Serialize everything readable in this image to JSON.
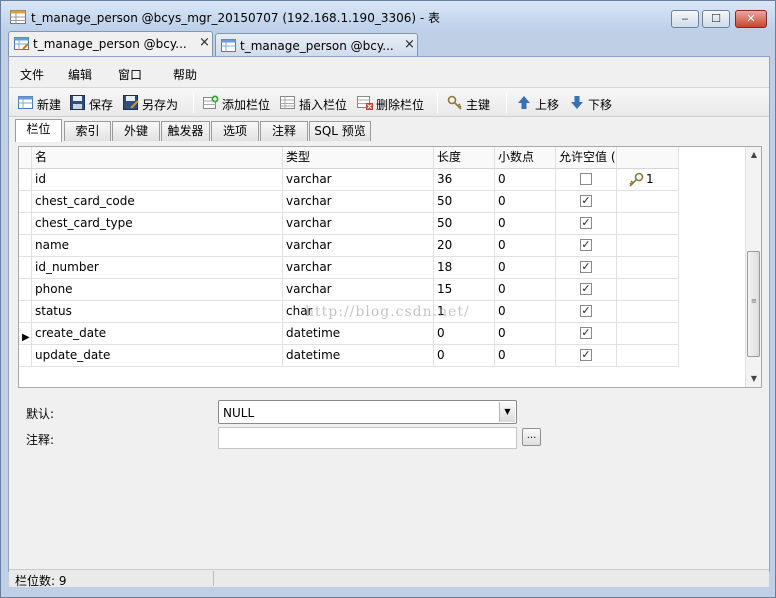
{
  "window": {
    "title": "t_manage_person @bcys_mgr_20150707 (192.168.1.190_3306) - 表",
    "minimize": "‒",
    "maximize": "☐",
    "close": "✕"
  },
  "doc_tabs": [
    {
      "label": "t_manage_person @bcy...",
      "close": "×"
    },
    {
      "label": "t_manage_person @bcy...",
      "close": "×"
    }
  ],
  "menu": [
    "文件",
    "编辑",
    "窗口",
    "帮助"
  ],
  "toolbar": {
    "new": "新建",
    "save": "保存",
    "save_as": "另存为",
    "add_column": "添加栏位",
    "insert_column": "插入栏位",
    "delete_column": "删除栏位",
    "primary_key": "主键",
    "move_up": "上移",
    "move_down": "下移"
  },
  "sub_tabs": [
    "栏位",
    "索引",
    "外键",
    "触发器",
    "选项",
    "注释",
    "SQL 预览"
  ],
  "grid": {
    "headers": [
      "名",
      "类型",
      "长度",
      "小数点",
      "允许空值 (",
      ""
    ],
    "rows": [
      {
        "name": "id",
        "type": "varchar",
        "length": "36",
        "decimals": "0",
        "nullable": false,
        "key": "1"
      },
      {
        "name": "chest_card_code",
        "type": "varchar",
        "length": "50",
        "decimals": "0",
        "nullable": true,
        "key": ""
      },
      {
        "name": "chest_card_type",
        "type": "varchar",
        "length": "50",
        "decimals": "0",
        "nullable": true,
        "key": ""
      },
      {
        "name": "name",
        "type": "varchar",
        "length": "20",
        "decimals": "0",
        "nullable": true,
        "key": ""
      },
      {
        "name": "id_number",
        "type": "varchar",
        "length": "18",
        "decimals": "0",
        "nullable": true,
        "key": ""
      },
      {
        "name": "phone",
        "type": "varchar",
        "length": "15",
        "decimals": "0",
        "nullable": true,
        "key": ""
      },
      {
        "name": "status",
        "type": "char",
        "length": "1",
        "decimals": "0",
        "nullable": true,
        "key": ""
      },
      {
        "name": "create_date",
        "type": "datetime",
        "length": "0",
        "decimals": "0",
        "nullable": true,
        "key": "",
        "current": true
      },
      {
        "name": "update_date",
        "type": "datetime",
        "length": "0",
        "decimals": "0",
        "nullable": true,
        "key": ""
      }
    ],
    "current_row_marker": "▶",
    "check_mark": "✓"
  },
  "watermark": "http://blog.csdn.net/",
  "properties": {
    "default_label": "默认:",
    "default_value": "NULL",
    "comment_label": "注释:",
    "comment_value": "",
    "ellipsis": "..."
  },
  "status": {
    "columns_count": "栏位数: 9"
  },
  "icons": {
    "key": "key-icon",
    "accent": "#3a6fb5"
  }
}
